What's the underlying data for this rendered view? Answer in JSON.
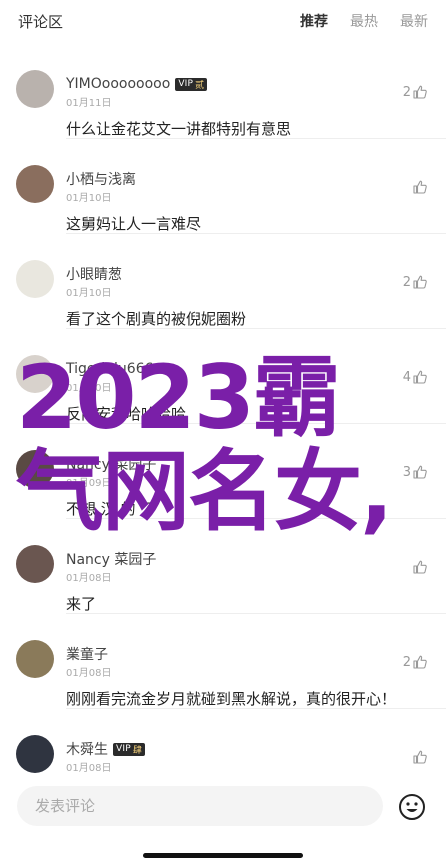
{
  "header": {
    "title": "评论区",
    "tabs": [
      {
        "label": "推荐",
        "active": true
      },
      {
        "label": "最热",
        "active": false
      },
      {
        "label": "最新",
        "active": false
      }
    ]
  },
  "comments": [
    {
      "username": "YIMOoooooooo",
      "vip": true,
      "vip_label": "VIP",
      "vip_level": "贰",
      "date": "01月11日",
      "text": "什么让金花艾文一讲都特别有意思",
      "likes": "2",
      "avatar_color": "#b9b2ad"
    },
    {
      "username": "小栖与浅离",
      "vip": false,
      "vip_label": "",
      "vip_level": "",
      "date": "01月10日",
      "text": "这舅妈让人一言难尽",
      "likes": "",
      "avatar_color": "#8a6e5e"
    },
    {
      "username": "小眼睛葱",
      "vip": false,
      "vip_label": "",
      "vip_level": "",
      "date": "01月10日",
      "text": "看了这个剧真的被倪妮圈粉",
      "likes": "2",
      "avatar_color": "#e9e7df"
    },
    {
      "username": "Tigerlulu666",
      "vip": false,
      "vip_label": "",
      "vip_level": "",
      "date": "01月10日",
      "text": "反向安利哈哈哈哈",
      "likes": "4",
      "avatar_color": "#d8d2cc"
    },
    {
      "username": "Nancy 菜园子",
      "vip": false,
      "vip_label": "",
      "vip_level": "",
      "date": "01月09日",
      "text": "不想 汉 的 了",
      "likes": "3",
      "avatar_color": "#5a4a44"
    },
    {
      "username": "Nancy 菜园子",
      "vip": false,
      "vip_label": "",
      "vip_level": "",
      "date": "01月08日",
      "text": "来了",
      "likes": "",
      "avatar_color": "#6a5650"
    },
    {
      "username": "業童子",
      "vip": false,
      "vip_label": "",
      "vip_level": "",
      "date": "01月08日",
      "text": "刚刚看完流金岁月就碰到黑水解说，真的很开心！",
      "likes": "2",
      "avatar_color": "#8a7a5a"
    },
    {
      "username": "木舜生",
      "vip": true,
      "vip_label": "VIP",
      "vip_level": "肆",
      "date": "01月08日",
      "text": "",
      "likes": "",
      "avatar_color": "#2f3440"
    }
  ],
  "overlay": {
    "line1": "2023霸",
    "line2": "气网名女,",
    "color": "#7a1fa8"
  },
  "input": {
    "placeholder": "发表评论"
  },
  "icons": {
    "like": "thumbs-up-icon",
    "emoji": "emoji-icon"
  }
}
